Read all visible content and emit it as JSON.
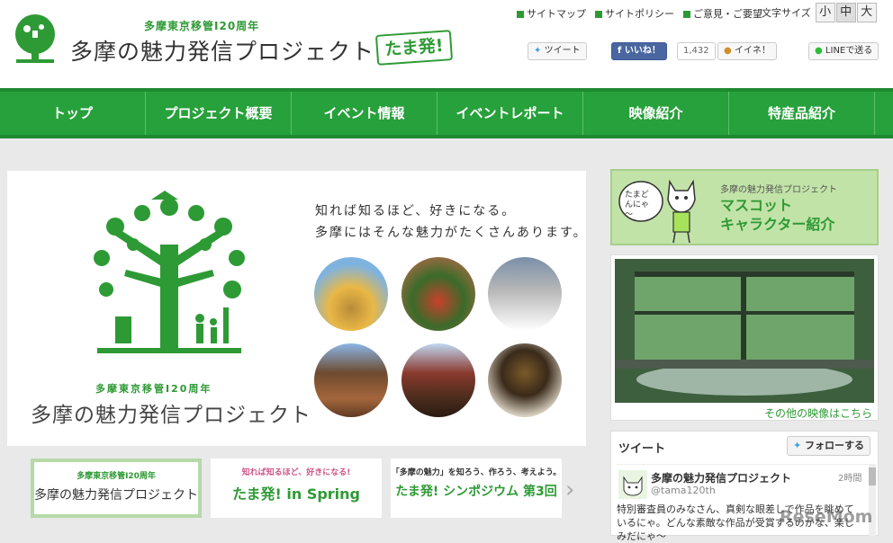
{
  "header": {
    "subtitle": "多摩東京移管I20周年",
    "title": "多摩の魅力発信プロジェクト",
    "stamp": "たま発!",
    "util_links": [
      "サイトマップ",
      "サイトポリシー",
      "ご意見・ご要望"
    ],
    "font_size_label": "文字サイズ",
    "font_sizes": [
      "小",
      "中",
      "大"
    ],
    "share": {
      "tweet": "ツイート",
      "like": "いいね！",
      "like_count": "1,432",
      "iine": "イイネ！",
      "line": "LINEで送る"
    }
  },
  "nav": [
    "トップ",
    "プロジェクト概要",
    "イベント情報",
    "イベントレポート",
    "映像紹介",
    "特産品紹介"
  ],
  "hero": {
    "tagline1": "知れば知るほど、好きになる。",
    "tagline2": "多摩にはそんな魅力がたくさんあります。",
    "sub": "多摩東京移管I20周年",
    "title": "多摩の魅力発信プロジェクト"
  },
  "banners": [
    {
      "small": "多摩東京移管I20周年",
      "big": "多摩の魅力発信プロジェクト"
    },
    {
      "small": "知れば知るほど、好きになる!",
      "big": "たま発! in Spring"
    },
    {
      "small": "「多摩の魅力」を知ろう、作ろう、考えよう。",
      "big": "たま発! シンポジウム 第3回"
    }
  ],
  "mascot": {
    "sub": "多摩の魅力発信プロジェクト",
    "title1": "マスコット",
    "title2": "キャラクター紹介",
    "speech": "たまどんにゃ～"
  },
  "video": {
    "more": "その他の映像はこちら"
  },
  "tweets": {
    "heading": "ツイート",
    "follow": "フォローする",
    "name": "多摩の魅力発信プロジェクト",
    "handle": "@tama120th",
    "time": "2時間",
    "text": "特別審査員のみなさん、真剣な眼差しで作品を眺めているにゃ。どんな素敵な作品が受賞するのかな、楽しみだにゃ～"
  },
  "watermark": "ReseMom",
  "colors": {
    "brand_green": "#27a13b",
    "accent_green": "#2e9a35"
  }
}
